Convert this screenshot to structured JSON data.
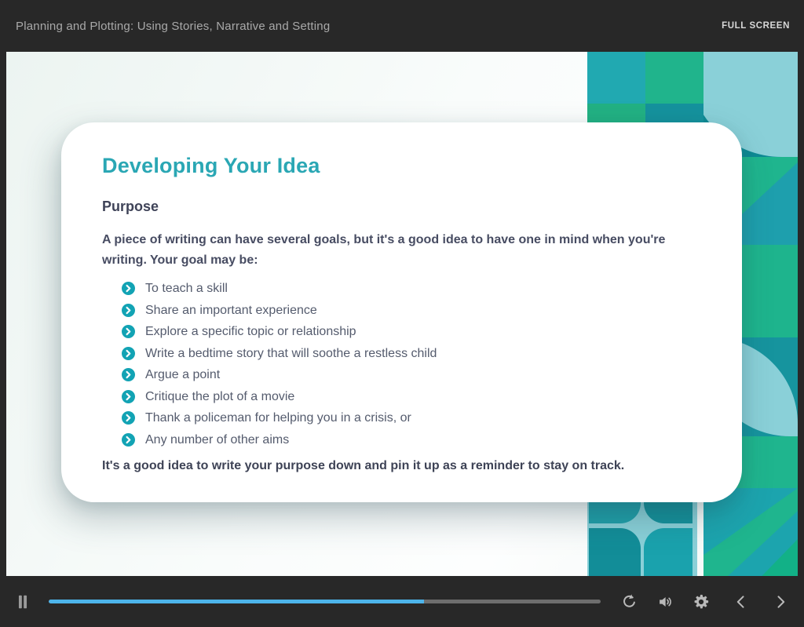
{
  "header": {
    "title": "Planning and Plotting: Using Stories, Narrative and Setting",
    "fullscreen_label": "FULL SCREEN"
  },
  "slide": {
    "title": "Developing Your Idea",
    "subtitle": "Purpose",
    "intro": "A piece of writing can have several goals, but it's a good idea to have one in mind when you're writing. Your goal may be:",
    "bullets": [
      "To teach a skill",
      "Share an important experience",
      "Explore a specific topic or relationship",
      "Write a bedtime story that will soothe a restless child",
      "Argue a point",
      "Critique the plot of a movie",
      "Thank a policeman for helping you in a crisis, or",
      "Any number of other aims"
    ],
    "closing": "It's a good idea to write your purpose down and pin it up as a reminder to stay on track."
  },
  "player": {
    "progress_percent": 68,
    "icons": {
      "pause": "pause-icon",
      "replay": "replay-icon",
      "volume": "volume-icon",
      "settings": "gear-icon",
      "previous": "chevron-left-icon",
      "next": "chevron-right-icon"
    }
  },
  "colors": {
    "teal": "#1CA3AD",
    "dark_teal": "#0E8A94",
    "green": "#1FB58E",
    "light_teal": "#8AD0D8",
    "title_teal": "#2AA7B4",
    "progress_blue": "#4DB4EA",
    "chrome": "#282828"
  }
}
